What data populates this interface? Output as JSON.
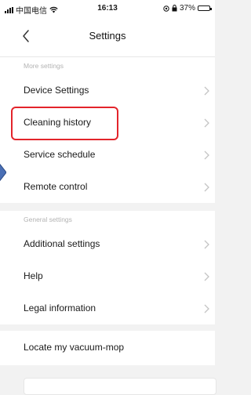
{
  "status_bar": {
    "carrier": "中国电信",
    "time": "16:13",
    "battery": "37%",
    "battery_level": 0.37
  },
  "header": {
    "title": "Settings"
  },
  "more_settings": {
    "label": "More settings",
    "items": [
      {
        "label": "Device Settings"
      },
      {
        "label": "Cleaning history"
      },
      {
        "label": "Service schedule"
      },
      {
        "label": "Remote control"
      }
    ]
  },
  "general_settings": {
    "label": "General settings",
    "items": [
      {
        "label": "Additional settings"
      },
      {
        "label": "Help"
      },
      {
        "label": "Legal information"
      }
    ]
  },
  "extra": {
    "locate_label": "Locate my vacuum-mop"
  },
  "colors": {
    "highlight": "#e3242b",
    "arrow": "#4a6fb5",
    "background": "#f2f2f2"
  },
  "icons": {
    "back": "chevron-left-icon",
    "row": "chevron-right-icon",
    "wifi": "wifi-icon",
    "battery": "battery-icon",
    "signal": "signal-icon",
    "location": "location-icon",
    "lock": "orientation-lock-icon"
  }
}
